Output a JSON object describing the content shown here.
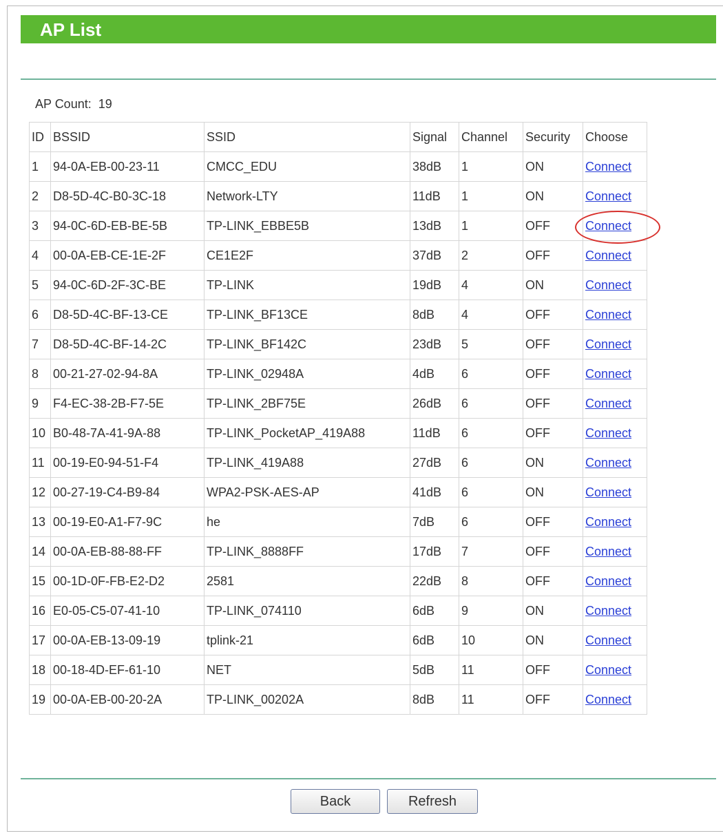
{
  "header": {
    "title": "AP List"
  },
  "ap_count": {
    "label": "AP Count:",
    "value": "19"
  },
  "columns": [
    "ID",
    "BSSID",
    "SSID",
    "Signal",
    "Channel",
    "Security",
    "Choose"
  ],
  "rows": [
    {
      "id": "1",
      "bssid": "94-0A-EB-00-23-11",
      "ssid": "CMCC_EDU",
      "signal": "38dB",
      "channel": "1",
      "security": "ON",
      "action": "Connect"
    },
    {
      "id": "2",
      "bssid": "D8-5D-4C-B0-3C-18",
      "ssid": "Network-LTY",
      "signal": "11dB",
      "channel": "1",
      "security": "ON",
      "action": "Connect"
    },
    {
      "id": "3",
      "bssid": "94-0C-6D-EB-BE-5B",
      "ssid": "TP-LINK_EBBE5B",
      "signal": "13dB",
      "channel": "1",
      "security": "OFF",
      "action": "Connect"
    },
    {
      "id": "4",
      "bssid": "00-0A-EB-CE-1E-2F",
      "ssid": "CE1E2F",
      "signal": "37dB",
      "channel": "2",
      "security": "OFF",
      "action": "Connect"
    },
    {
      "id": "5",
      "bssid": "94-0C-6D-2F-3C-BE",
      "ssid": "TP-LINK",
      "signal": "19dB",
      "channel": "4",
      "security": "ON",
      "action": "Connect"
    },
    {
      "id": "6",
      "bssid": "D8-5D-4C-BF-13-CE",
      "ssid": "TP-LINK_BF13CE",
      "signal": "8dB",
      "channel": "4",
      "security": "OFF",
      "action": "Connect"
    },
    {
      "id": "7",
      "bssid": "D8-5D-4C-BF-14-2C",
      "ssid": "TP-LINK_BF142C",
      "signal": "23dB",
      "channel": "5",
      "security": "OFF",
      "action": "Connect"
    },
    {
      "id": "8",
      "bssid": "00-21-27-02-94-8A",
      "ssid": "TP-LINK_02948A",
      "signal": "4dB",
      "channel": "6",
      "security": "OFF",
      "action": "Connect"
    },
    {
      "id": "9",
      "bssid": "F4-EC-38-2B-F7-5E",
      "ssid": "TP-LINK_2BF75E",
      "signal": "26dB",
      "channel": "6",
      "security": "OFF",
      "action": "Connect"
    },
    {
      "id": "10",
      "bssid": "B0-48-7A-41-9A-88",
      "ssid": "TP-LINK_PocketAP_419A88",
      "signal": "11dB",
      "channel": "6",
      "security": "OFF",
      "action": "Connect"
    },
    {
      "id": "11",
      "bssid": "00-19-E0-94-51-F4",
      "ssid": "TP-LINK_419A88",
      "signal": "27dB",
      "channel": "6",
      "security": "ON",
      "action": "Connect"
    },
    {
      "id": "12",
      "bssid": "00-27-19-C4-B9-84",
      "ssid": "WPA2-PSK-AES-AP",
      "signal": "41dB",
      "channel": "6",
      "security": "ON",
      "action": "Connect"
    },
    {
      "id": "13",
      "bssid": "00-19-E0-A1-F7-9C",
      "ssid": "he",
      "signal": "7dB",
      "channel": "6",
      "security": "OFF",
      "action": "Connect"
    },
    {
      "id": "14",
      "bssid": "00-0A-EB-88-88-FF",
      "ssid": "TP-LINK_8888FF",
      "signal": "17dB",
      "channel": "7",
      "security": "OFF",
      "action": "Connect"
    },
    {
      "id": "15",
      "bssid": "00-1D-0F-FB-E2-D2",
      "ssid": "2581",
      "signal": "22dB",
      "channel": "8",
      "security": "OFF",
      "action": "Connect"
    },
    {
      "id": "16",
      "bssid": "E0-05-C5-07-41-10",
      "ssid": "TP-LINK_074110",
      "signal": "6dB",
      "channel": "9",
      "security": "ON",
      "action": "Connect"
    },
    {
      "id": "17",
      "bssid": "00-0A-EB-13-09-19",
      "ssid": "tplink-21",
      "signal": "6dB",
      "channel": "10",
      "security": "ON",
      "action": "Connect"
    },
    {
      "id": "18",
      "bssid": "00-18-4D-EF-61-10",
      "ssid": "NET",
      "signal": "5dB",
      "channel": "11",
      "security": "OFF",
      "action": "Connect"
    },
    {
      "id": "19",
      "bssid": "00-0A-EB-00-20-2A",
      "ssid": "TP-LINK_00202A",
      "signal": "8dB",
      "channel": "11",
      "security": "OFF",
      "action": "Connect"
    }
  ],
  "buttons": {
    "back": "Back",
    "refresh": "Refresh"
  },
  "colors": {
    "title_bar": "#5cb832",
    "link": "#2a3fd6",
    "highlight": "#d8302c",
    "rule": "#6fb39a"
  }
}
